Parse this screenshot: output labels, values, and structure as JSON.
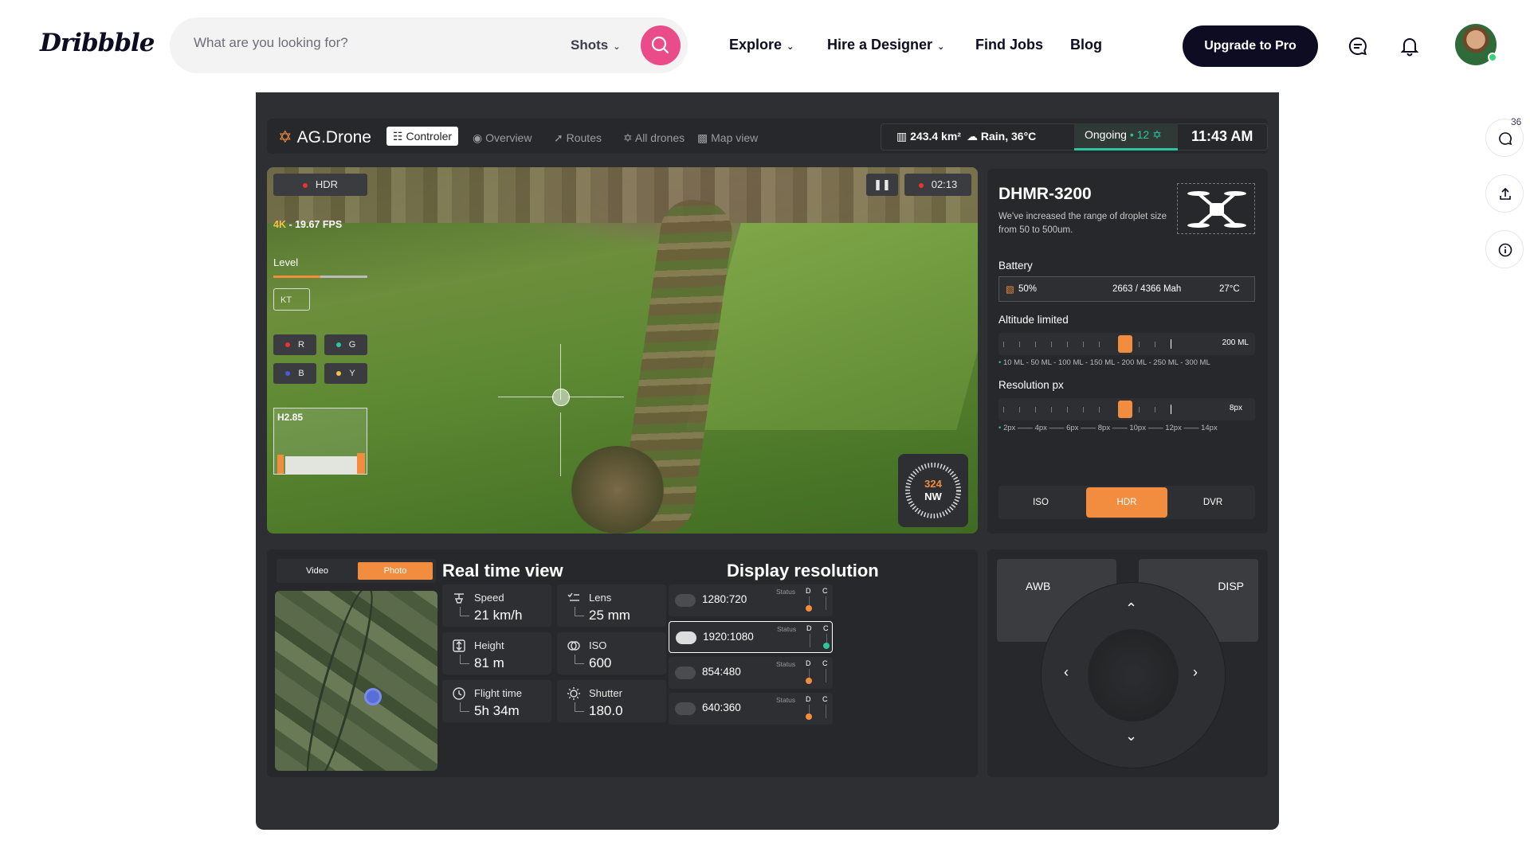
{
  "header": {
    "logo": "Dribbble",
    "search_placeholder": "What are you looking for?",
    "search_scope": "Shots",
    "nav": [
      "Explore",
      "Hire a Designer",
      "Find Jobs",
      "Blog"
    ],
    "upgrade": "Upgrade to Pro",
    "side_count": "36"
  },
  "app": {
    "brand": "AG.Drone",
    "tabs": [
      "Controler",
      "Overview",
      "Routes",
      "All drones",
      "Map view"
    ],
    "area": "243.4 km²",
    "weather": "Rain, 36°C",
    "ongoing": "Ongoing",
    "ongoing_count": "12",
    "time": "11:43 AM"
  },
  "video": {
    "hdr": "HDR",
    "rec_time": "02:13",
    "fps_prefix": "4K",
    "fps": " - 19.67 FPS",
    "level": "Level",
    "kt": "KT",
    "channels": [
      "R",
      "G",
      "B",
      "Y"
    ],
    "hist_label": "H2.85",
    "heading": "324",
    "direction": "NW"
  },
  "drone": {
    "model": "DHMR-3200",
    "desc": "We've increased the range of  droplet size from  50 to 500um.",
    "battery_label": "Battery",
    "battery_pct": "50%",
    "battery_mah": "2663 / 4366  Mah",
    "battery_temp": "27°C",
    "altitude_label": "Altitude limited",
    "altitude_value": "200 ML",
    "altitude_scale": "10 ML - 50 ML - 100 ML - 150 ML - 200 ML - 250 ML - 300 ML",
    "resolution_label": "Resolution px",
    "resolution_value": "8px",
    "resolution_scale": "2px ——  4px ——  6px ——  8px ——  10px ——  12px ——  14px",
    "modes": [
      "ISO",
      "HDR",
      "DVR"
    ]
  },
  "realtime": {
    "toggle": [
      "Video",
      "Photo"
    ],
    "title": "Real time view",
    "metrics": [
      {
        "label": "Speed",
        "value": "21 km/h"
      },
      {
        "label": "Lens",
        "value": "25 mm"
      },
      {
        "label": "Height",
        "value": "81 m"
      },
      {
        "label": "ISO",
        "value": "600"
      },
      {
        "label": "Flight time",
        "value": "5h 34m"
      },
      {
        "label": "Shutter",
        "value": "180.0"
      }
    ]
  },
  "display": {
    "title": "Display resolution",
    "status": "Status",
    "d": "D",
    "c": "C",
    "items": [
      "1280:720",
      "1920:1080",
      "854:480",
      "640:360"
    ]
  },
  "controller": {
    "left": "AWB",
    "right": "DISP"
  }
}
